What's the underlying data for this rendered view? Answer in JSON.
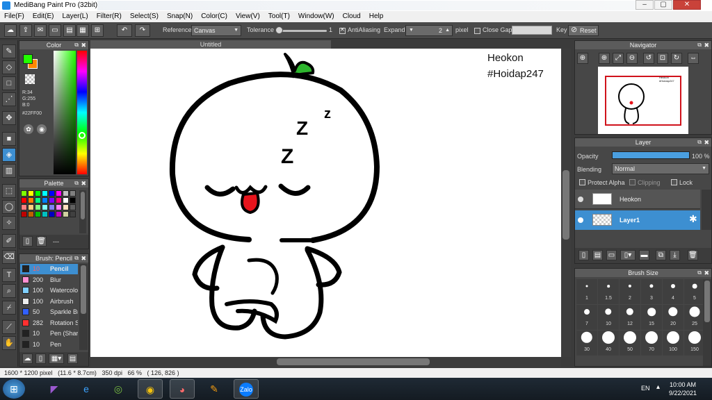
{
  "window": {
    "title": "MediBang Paint Pro (32bit)",
    "buttons": [
      "–",
      "▢",
      "✕"
    ]
  },
  "menu": [
    "File(F)",
    "Edit(E)",
    "Layer(L)",
    "Filter(R)",
    "Select(S)",
    "Snap(N)",
    "Color(C)",
    "View(V)",
    "Tool(T)",
    "Window(W)",
    "Cloud",
    "Help"
  ],
  "toolbar": {
    "reference_label": "Reference",
    "reference_value": "Canvas",
    "tolerance_label": "Tolerance",
    "tolerance_value": "1",
    "antialiasing_label": "AntiAliasing",
    "expand_label": "Expand",
    "expand_value": "2",
    "expand_unit": "pixel",
    "close_gaps_label": "Close Gaps",
    "key_label": "Key",
    "reset_label": "Reset"
  },
  "color_panel": {
    "title": "Color",
    "r": "R:34",
    "g": "G:255",
    "b": "B:0",
    "hex": "#22FF00",
    "fg_color": "#22ff00",
    "bg_color": "#ff8800"
  },
  "palette_panel": {
    "title": "Palette",
    "footer": "---",
    "swatches": [
      "#7fff00",
      "#ffff00",
      "#00ff00",
      "#00ffff",
      "#0000ff",
      "#ff00ff",
      "#c0c0c0",
      "#808080",
      "#ff0000",
      "#ff8000",
      "#00ff80",
      "#0080ff",
      "#8000ff",
      "#ff0080",
      "#ffffff",
      "#000000",
      "#ff8080",
      "#ffd080",
      "#80ff80",
      "#80ffff",
      "#8080ff",
      "#ff80ff",
      "#ffe0c0",
      "#606060",
      "#c00000",
      "#c06000",
      "#00c000",
      "#00c0c0",
      "#0000c0",
      "#c000c0",
      "#d0d0a0",
      "#404040"
    ]
  },
  "brush_panel": {
    "title": "Brush: Pencil",
    "items": [
      {
        "size": "10",
        "name": "Pencil",
        "color": "#222222",
        "selected": true
      },
      {
        "size": "200",
        "name": "Blur",
        "color": "#ff8fd0"
      },
      {
        "size": "100",
        "name": "Watercolor",
        "color": "#80d0ff"
      },
      {
        "size": "100",
        "name": "Airbrush",
        "color": "#eeeeee"
      },
      {
        "size": "50",
        "name": "Sparkle Brush",
        "color": "#3060ff"
      },
      {
        "size": "282",
        "name": "Rotation Sym",
        "color": "#ff3030"
      },
      {
        "size": "10",
        "name": "Pen (Sharp)",
        "color": "#222222"
      },
      {
        "size": "10",
        "name": "Pen",
        "color": "#222222"
      }
    ]
  },
  "canvas": {
    "tab_title": "Untitled",
    "text_line1": "Heokon",
    "text_line2": "#Hoidap247",
    "sleep_z1": "z",
    "sleep_z2": "Z",
    "sleep_z3": "Z"
  },
  "navigator": {
    "title": "Navigator",
    "mini_text1": "Heokon",
    "mini_text2": "#Hoidap247"
  },
  "layer_panel": {
    "title": "Layer",
    "opacity_label": "Opacity",
    "opacity_value": "100 %",
    "opacity_fraction": 1.0,
    "blending_label": "Blending",
    "blending_value": "Normal",
    "protect_alpha": "Protect Alpha",
    "clipping": "Clipping",
    "lock": "Lock",
    "layers": [
      {
        "name": "Heokon",
        "selected": false
      },
      {
        "name": "Layer1",
        "selected": true
      }
    ]
  },
  "brush_size_panel": {
    "title": "Brush Size",
    "sizes": [
      "1",
      "1.5",
      "2",
      "3",
      "4",
      "5",
      "7",
      "10",
      "12",
      "15",
      "20",
      "25",
      "30",
      "40",
      "50",
      "70",
      "100",
      "150"
    ]
  },
  "status": {
    "dimensions": "1600 * 1200 pixel",
    "physical": "(11.6 * 8.7cm)",
    "dpi": "350 dpi",
    "zoom": "66 %",
    "coords": "( 126, 826 )"
  },
  "taskbar": {
    "lang": "EN",
    "time": "10:00 AM",
    "date": "9/22/2021",
    "zalo": "Zalo"
  }
}
